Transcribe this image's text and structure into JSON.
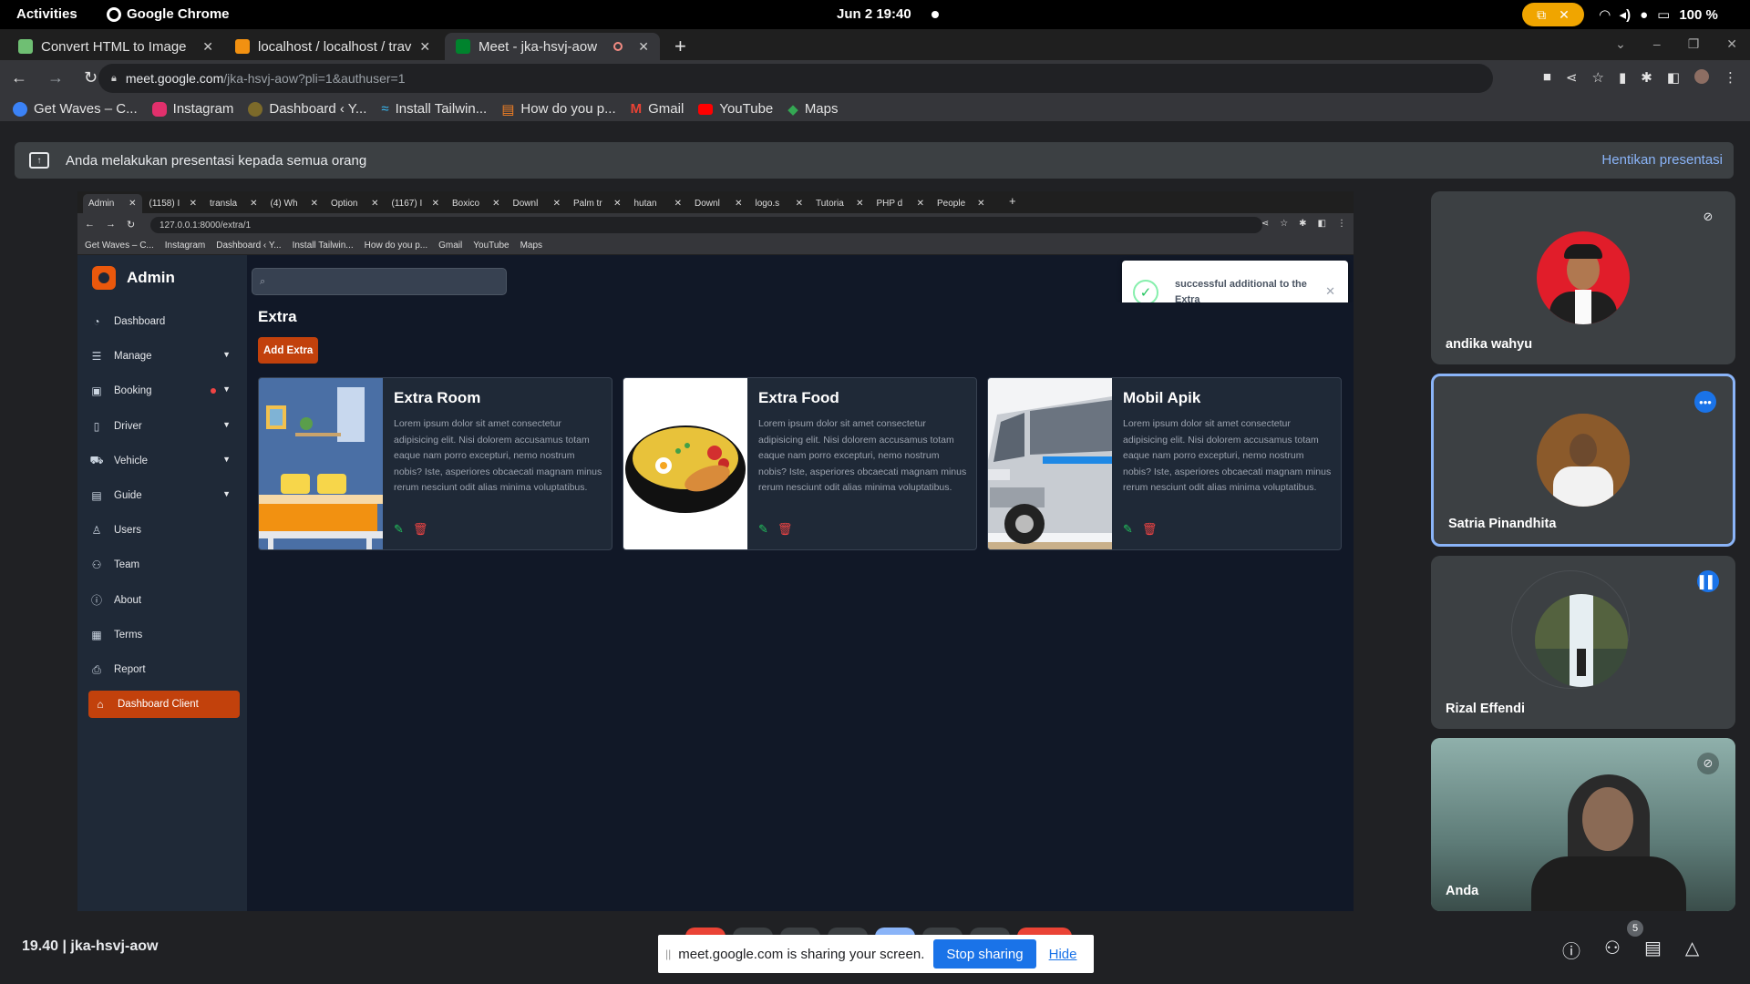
{
  "topbar": {
    "activities": "Activities",
    "app": "Google Chrome",
    "clock": "Jun 2  19:40",
    "battery": "100 %"
  },
  "chrome": {
    "tabs": [
      {
        "title": "Convert HTML to Image",
        "color": "#2e7d32"
      },
      {
        "title": "localhost / localhost / trav",
        "color": "#f29111"
      },
      {
        "title": "Meet - jka-hsvj-aow",
        "color": "#00832d"
      }
    ],
    "url_host": "meet.google.com",
    "url_path": "/jka-hsvj-aow?pli=1&authuser=1",
    "bookmarks": [
      "Get Waves – C...",
      "Instagram",
      "Dashboard ‹ Y...",
      "Install Tailwin...",
      "How do you p...",
      "Gmail",
      "YouTube",
      "Maps"
    ]
  },
  "meet": {
    "banner": "Anda melakukan presentasi kepada semua orang",
    "stop_presenting": "Hentikan presentasi",
    "code": "19.40  |  jka-hsvj-aow",
    "people_count": "5",
    "share_text": "meet.google.com is sharing your screen.",
    "stop_sharing": "Stop sharing",
    "hide": "Hide",
    "participants": [
      {
        "name": "andika wahyu"
      },
      {
        "name": "Satria Pinandhita"
      },
      {
        "name": "Rizal Effendi"
      },
      {
        "name": "Anda"
      }
    ]
  },
  "shared": {
    "tabs": [
      "Admin",
      "(1158) I",
      "transla",
      "(4) Wh",
      "Option",
      "(1167) I",
      "Boxico",
      "Downl",
      "Palm tr",
      "hutan",
      "Downl",
      "logo.s",
      "Tutoria",
      "PHP d",
      "People"
    ],
    "url": "127.0.0.1:8000/extra/1",
    "bookmarks": [
      "Get Waves – C...",
      "Instagram",
      "Dashboard ‹ Y...",
      "Install Tailwin...",
      "How do you p...",
      "Gmail",
      "YouTube",
      "Maps"
    ],
    "app": {
      "brand": "Admin",
      "sidebar": [
        "Dashboard",
        "Manage",
        "Booking",
        "Driver",
        "Vehicle",
        "Guide",
        "Users",
        "Team",
        "About",
        "Terms",
        "Report",
        "Dashboard Client"
      ],
      "page_title": "Extra",
      "add_button": "Add Extra",
      "toast": "successful additional to the Extra",
      "cards": [
        {
          "title": "Extra Room",
          "desc": "Lorem ipsum dolor sit amet consectetur adipisicing elit. Nisi dolorem accusamus totam eaque nam porro excepturi, nemo nostrum nobis? Iste, asperiores obcaecati magnam minus rerum nesciunt odit alias minima voluptatibus."
        },
        {
          "title": "Extra Food",
          "desc": "Lorem ipsum dolor sit amet consectetur adipisicing elit. Nisi dolorem accusamus totam eaque nam porro excepturi, nemo nostrum nobis? Iste, asperiores obcaecati magnam minus rerum nesciunt odit alias minima voluptatibus."
        },
        {
          "title": "Mobil Apik",
          "desc": "Lorem ipsum dolor sit amet consectetur adipisicing elit. Nisi dolorem accusamus totam eaque nam porro excepturi, nemo nostrum nobis? Iste, asperiores obcaecati magnam minus rerum nesciunt odit alias minima voluptatibus."
        }
      ]
    }
  }
}
